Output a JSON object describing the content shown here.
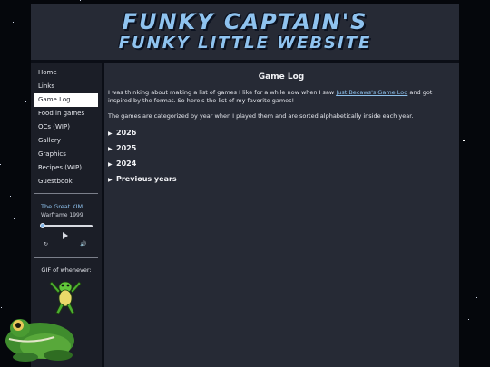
{
  "header": {
    "title_line1": "FUNKY CAPTAIN'S",
    "title_line2": "FUNKY LITTLE WEBSITE"
  },
  "sidebar": {
    "items": [
      {
        "label": "Home",
        "active": false
      },
      {
        "label": "Links",
        "active": false
      },
      {
        "label": "Game Log",
        "active": true
      },
      {
        "label": "Food in games",
        "active": false
      },
      {
        "label": "OCs (WIP)",
        "active": false
      },
      {
        "label": "Gallery",
        "active": false
      },
      {
        "label": "Graphics",
        "active": false
      },
      {
        "label": "Recipes (WIP)",
        "active": false
      },
      {
        "label": "Guestbook",
        "active": false
      }
    ]
  },
  "player": {
    "track": "The Great KIM",
    "artist": "Warframe 1999",
    "progress": 0.03,
    "play_icon": "play-icon",
    "repeat_icon": "repeat-icon",
    "volume_icon": "volume-icon"
  },
  "gif_box": {
    "label": "GIF of whenever:"
  },
  "main": {
    "title": "Game Log",
    "intro_before": "I was thinking about making a list of games I like for a while now when I saw ",
    "intro_link": "Just Becaws's Game Log",
    "intro_after": " and got inspired by the format. So here's the list of my favorite games!",
    "paragraph2": "The games are categorized by year when I played them and are sorted alphabetically inside each year.",
    "years": [
      "2026",
      "2025",
      "2024",
      "Previous years"
    ]
  },
  "colors": {
    "accent": "#8fc3ef",
    "panel": "#262a35",
    "sidebar": "#1b1e27",
    "background": "#05070c"
  }
}
